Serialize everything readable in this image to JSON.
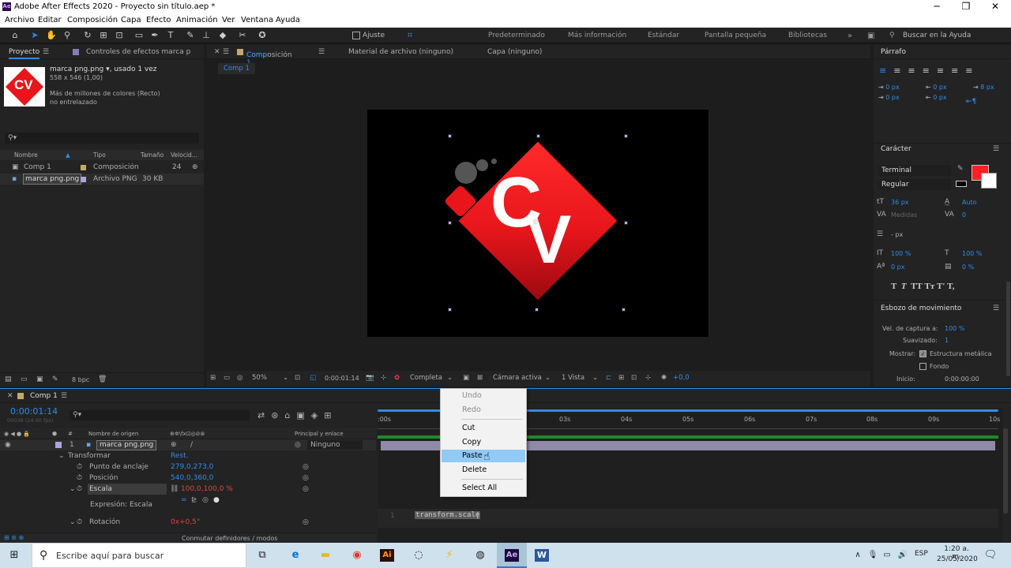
{
  "window": {
    "title": "Adobe After Effects 2020 - Proyecto sin título.aep *",
    "app_icon": "Ae",
    "minimize": "─",
    "maximize": "❐",
    "close": "✕"
  },
  "menu": [
    "Archivo",
    "Editar",
    "Composición",
    "Capa",
    "Efecto",
    "Animación",
    "Ver",
    "Ventana",
    "Ayuda"
  ],
  "toolbar": {
    "snap_label": "Ajuste",
    "workspaces": [
      "Predeterminado",
      "Más información",
      "Estándar",
      "Pantalla pequeña",
      "Bibliotecas"
    ],
    "search_placeholder": "Buscar en la Ayuda"
  },
  "project": {
    "tab": "Proyecto",
    "effects_tab": "Controles de efectos marca p",
    "asset_name": "marca png.png",
    "asset_used": ", usado 1 vez",
    "asset_dims": "558 x 546 (1,00)",
    "asset_colors": "Más de millones de colores (Recto)",
    "asset_interlace": "no entrelazado",
    "columns": [
      "Nombre",
      "Tipo",
      "Tamaño",
      "Velocid..."
    ],
    "items": [
      {
        "name": "Comp 1",
        "type": "Composición",
        "size": "24"
      },
      {
        "name": "marca png.png",
        "type": "Archivo PNG",
        "size": "30 KB"
      }
    ],
    "bpc": "8 bpc"
  },
  "comp": {
    "tab_prefix": "Composición",
    "tab_name": "Comp 1",
    "footage_tab": "Material de archivo (ninguno)",
    "layer_tab": "Capa (ninguno)",
    "breadcrumb": "Comp 1",
    "logo_text1": "C",
    "logo_text2": "V",
    "zoom": "50%",
    "timecode": "0:00:01:14",
    "resolution": "Completa",
    "camera": "Cámara activa",
    "views": "1 Vista",
    "exposure": "+0,0"
  },
  "paragraph": {
    "title": "Párrafo",
    "indent1": "0 px",
    "indent2": "0 px",
    "indent3": "0 px",
    "space1": "0 px",
    "space2": "8 px"
  },
  "character": {
    "title": "Carácter",
    "font": "Terminal",
    "style": "Regular",
    "size": "36 px",
    "leading": "Auto",
    "kerning": "Medidas",
    "tracking": "0",
    "stroke": "- px",
    "vscale": "100 %",
    "hscale": "100 %",
    "baseline": "0 px",
    "tsume": "0 %",
    "styles": [
      "T",
      "T",
      "TT",
      "Tт",
      "T'",
      "T,"
    ]
  },
  "motion": {
    "title": "Esbozo de movimiento",
    "capture_label": "Vel. de captura a:",
    "capture_value": "100 %",
    "smooth_label": "Suavizado:",
    "smooth_value": "1",
    "show_label": "Mostrar:",
    "wireframe": "Estructura metálica",
    "background": "Fondo",
    "start_label": "Inicio:",
    "start_value": "0:00:00:00"
  },
  "timeline": {
    "tab": "Comp 1",
    "timecode": "0:00:01:14",
    "fps": "00038 (24.00 fps)",
    "col_source": "Nombre de origen",
    "col_parent": "Principal y enlace",
    "layer_num": "1",
    "layer_name": "marca png.png",
    "parent": "Ninguno",
    "transform": "Transformar",
    "reset": "Rest.",
    "props": [
      {
        "name": "Punto de anclaje",
        "value": "279,0,273,0"
      },
      {
        "name": "Posición",
        "value": "540,0,360,0"
      },
      {
        "name": "Escala",
        "value": "100,0,100,0 %"
      },
      {
        "name": "Expresión: Escala",
        "value": ""
      },
      {
        "name": "Rotación",
        "value": "0x+0,5°"
      }
    ],
    "expression_text": "transform.scale",
    "expression_line": "1",
    "ruler": [
      ":00s",
      "03s",
      "04s",
      "05s",
      "06s",
      "07s",
      "08s",
      "09s",
      "10s"
    ],
    "footer": "Conmutar definidores / modos"
  },
  "context_menu": {
    "items": [
      "Undo",
      "Redo",
      "Cut",
      "Copy",
      "Paste",
      "Delete",
      "Select All"
    ]
  },
  "taskbar": {
    "search_placeholder": "Escribe aquí para buscar",
    "lang": "ESP",
    "time": "1:20 a. m.",
    "date": "25/05/2020"
  },
  "colors": {
    "accent": "#2d8ceb",
    "logo_red": "#e8161b",
    "highlight": "#91c9f7"
  }
}
